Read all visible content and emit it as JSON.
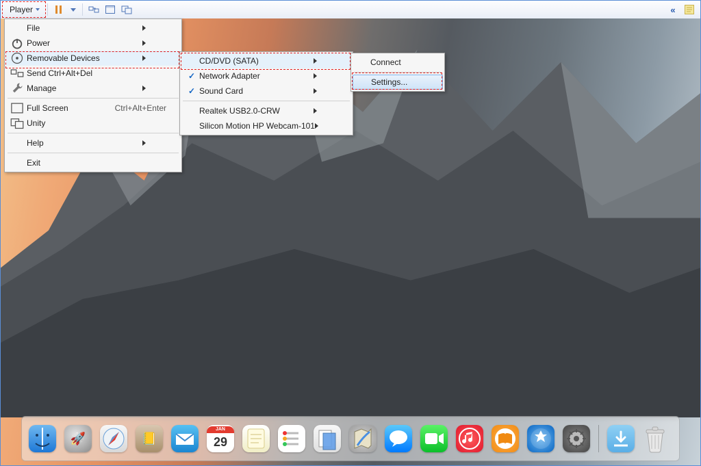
{
  "toolbar": {
    "player_label": "Player"
  },
  "main_menu": {
    "file": "File",
    "power": "Power",
    "removable": "Removable Devices",
    "send_cad": "Send Ctrl+Alt+Del",
    "manage": "Manage",
    "fullscreen": "Full Screen",
    "fullscreen_shortcut": "Ctrl+Alt+Enter",
    "unity": "Unity",
    "help": "Help",
    "exit": "Exit"
  },
  "removable_menu": {
    "cddvd": "CD/DVD (SATA)",
    "network": "Network Adapter",
    "sound": "Sound Card",
    "realtek": "Realtek USB2.0-CRW",
    "webcam": "Silicon Motion HP Webcam-101"
  },
  "cddvd_menu": {
    "connect": "Connect",
    "settings": "Settings..."
  },
  "dock": {
    "calendar_month": "JAN",
    "calendar_day": "29"
  }
}
